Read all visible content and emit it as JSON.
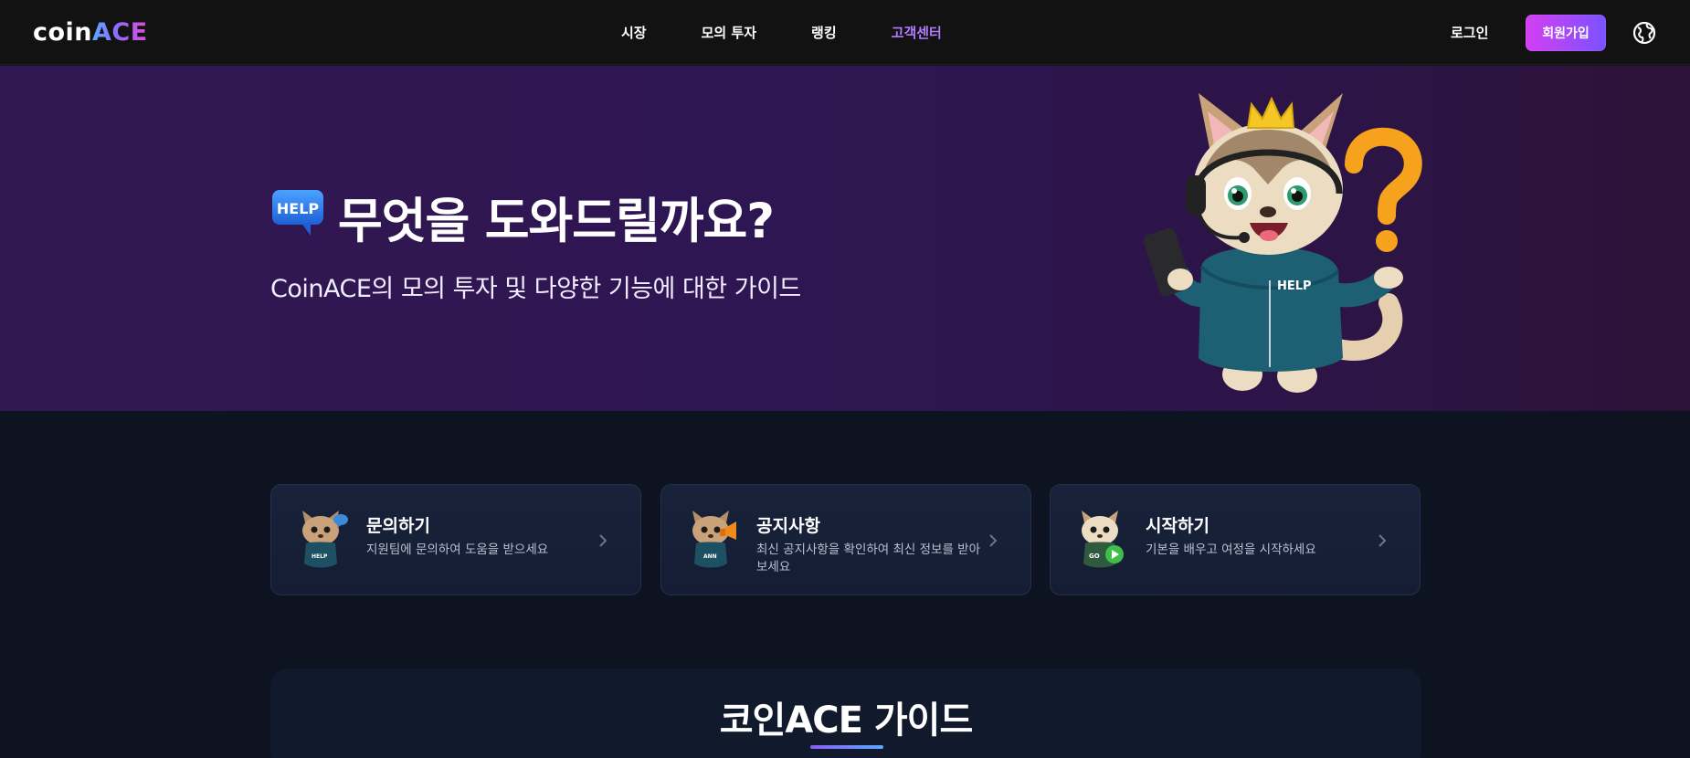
{
  "header": {
    "logo": {
      "coin": "coin",
      "ace": "ACE"
    },
    "nav": [
      {
        "label": "시장"
      },
      {
        "label": "모의 투자"
      },
      {
        "label": "랭킹"
      },
      {
        "label": "고객센터",
        "active": true
      }
    ],
    "login_label": "로그인",
    "signup_label": "회원가입",
    "language_icon": "globe-icon"
  },
  "hero": {
    "badge_text": "HELP",
    "title": "무엇을 도와드릴까요?",
    "subtitle": "CoinACE의 모의 투자 및 다양한 기능에 대한 가이드",
    "mascot_hoodie_text": "HELP"
  },
  "cards": [
    {
      "title": "문의하기",
      "description": "지원팀에 문의하여 도움을 받으세요",
      "mascot_badge": "HELP"
    },
    {
      "title": "공지사항",
      "description": "최신 공지사항을 확인하여 최신 정보를 받아보세요",
      "mascot_badge": "ANN"
    },
    {
      "title": "시작하기",
      "description": "기본을 배우고 여정을 시작하세요",
      "mascot_badge": "GO"
    }
  ],
  "guide": {
    "title": "코인ACE 가이드"
  },
  "colors": {
    "accent_purple": "#b07cff",
    "signup_gradient_start": "#d43ff2",
    "signup_gradient_end": "#7a52ff",
    "hero_bg": "#321851",
    "page_bg": "#0e1322"
  }
}
